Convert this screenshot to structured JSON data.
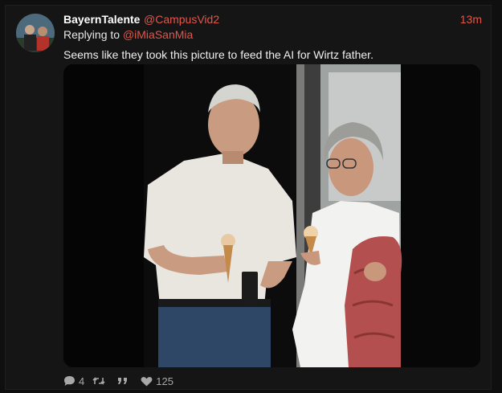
{
  "tweet": {
    "display_name": "BayernTalente",
    "handle": "@CampusVid2",
    "time": "13m",
    "replying_prefix": "Replying to",
    "reply_to": "@iMiaSanMia",
    "text": "Seems like they took this picture to feed the AI for Wirtz father."
  },
  "actions": {
    "reply_count": "4",
    "like_count": "125",
    "icons": [
      "comment-icon",
      "retweet-icon",
      "quote-icon",
      "heart-icon"
    ]
  },
  "colors": {
    "accent": "#e2574c",
    "background": "#0f0f0f",
    "muted": "#a8a8a8"
  }
}
